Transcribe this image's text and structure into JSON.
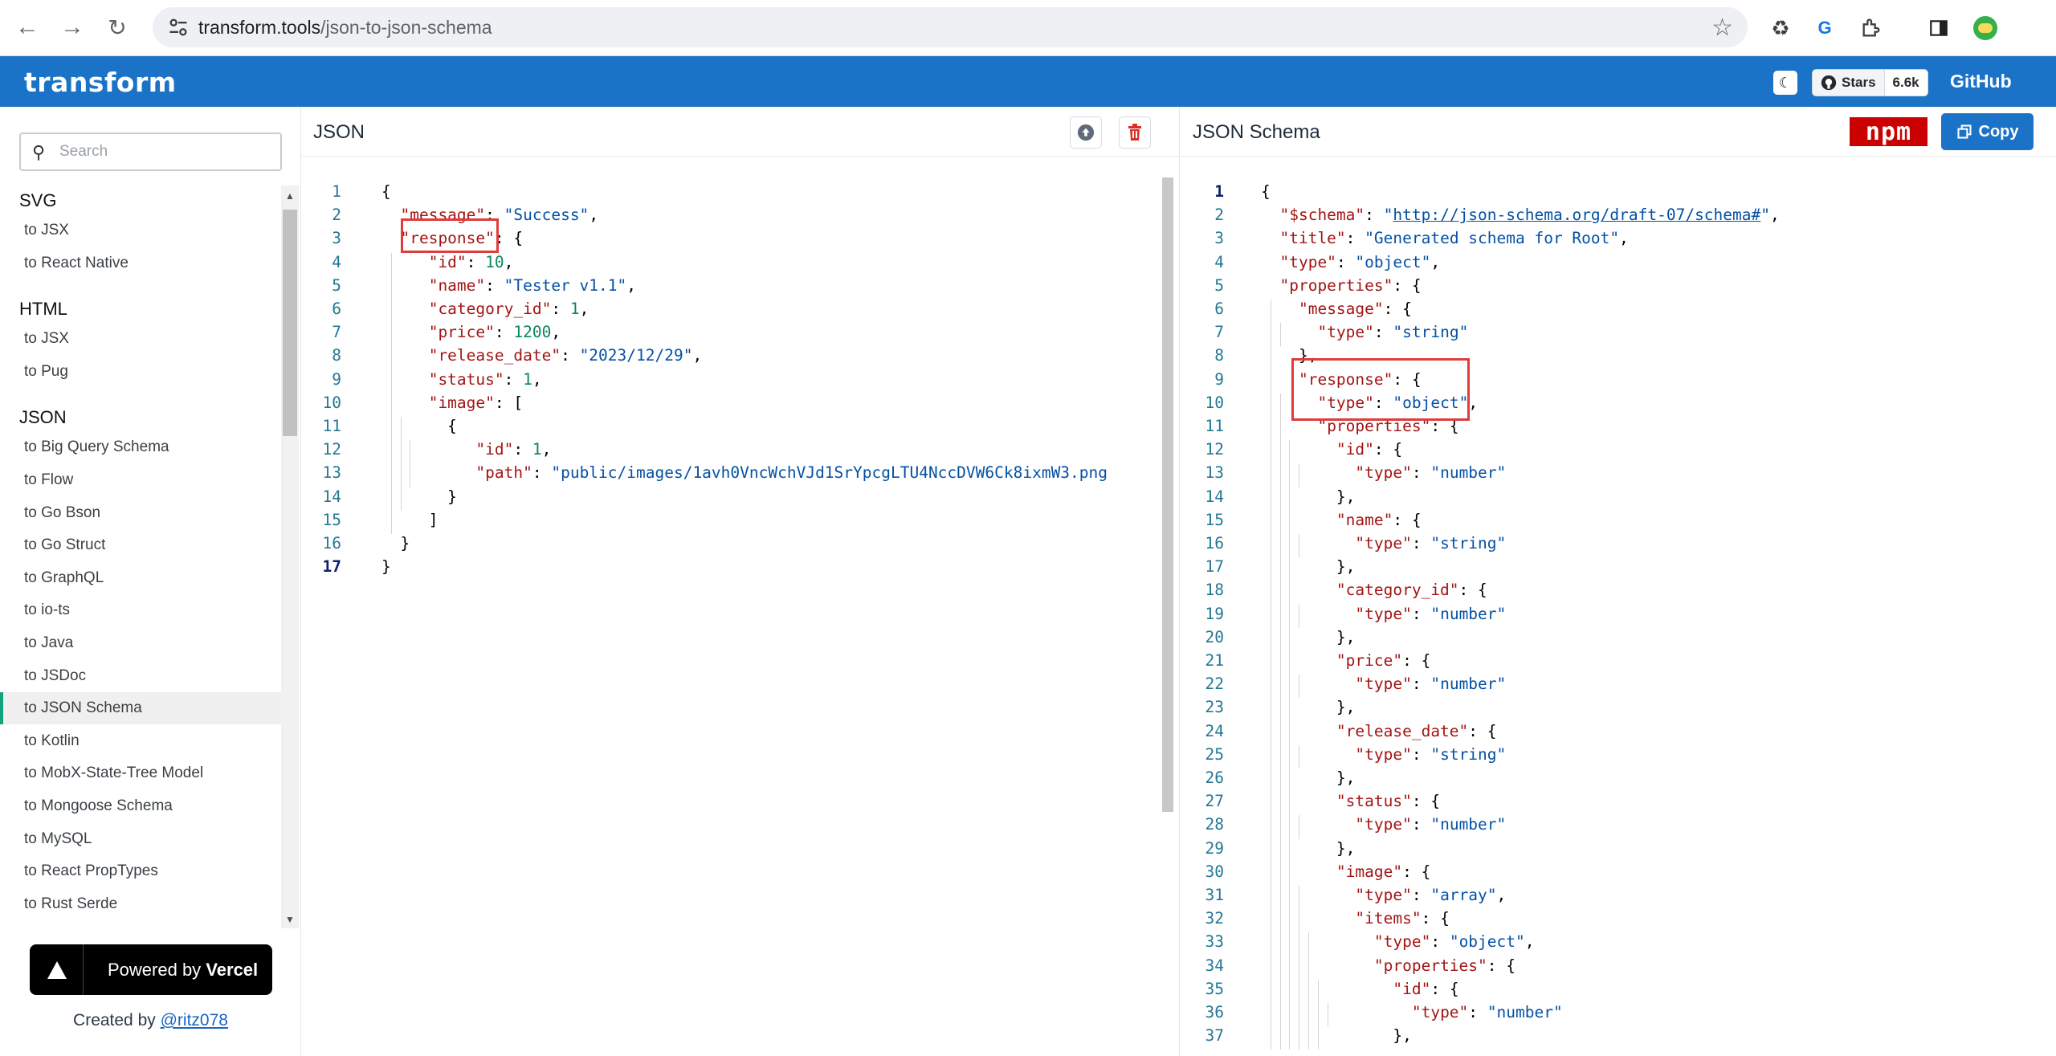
{
  "browser": {
    "url_host": "transform.tools",
    "url_path": "/json-to-json-schema"
  },
  "header": {
    "logo": "transform",
    "stars_label": "Stars",
    "stars_count": "6.6k",
    "github_label": "GitHub"
  },
  "sidebar": {
    "search_placeholder": "Search",
    "sections": [
      {
        "title": "SVG",
        "items": [
          "to JSX",
          "to React Native"
        ]
      },
      {
        "title": "HTML",
        "items": [
          "to JSX",
          "to Pug"
        ]
      },
      {
        "title": "JSON",
        "items": [
          "to Big Query Schema",
          "to Flow",
          "to Go Bson",
          "to Go Struct",
          "to GraphQL",
          "to io-ts",
          "to Java",
          "to JSDoc",
          "to JSON Schema",
          "to Kotlin",
          "to MobX-State-Tree Model",
          "to Mongoose Schema",
          "to MySQL",
          "to React PropTypes",
          "to Rust Serde"
        ]
      }
    ],
    "active_item": "to JSON Schema",
    "vercel_prefix": "Powered by",
    "vercel_brand": "Vercel",
    "created_prefix": "Created by",
    "created_author": "@ritz078"
  },
  "left_panel": {
    "title": "JSON",
    "lines": [
      "{",
      "  \"message\": \"Success\",",
      "  \"response\": {",
      "    \"id\": 10,",
      "    \"name\": \"Tester v1.1\",",
      "    \"category_id\": 1,",
      "    \"price\": 1200,",
      "    \"release_date\": \"2023/12/29\",",
      "    \"status\": 1,",
      "    \"image\": [",
      "      {",
      "        \"id\": 1,",
      "        \"path\": \"public/images/1avh0VncWchVJd1SrYpcgLTU4NccDVW6Ck8ixmW3.png",
      "      }",
      "    ]",
      "  }",
      "}"
    ]
  },
  "right_panel": {
    "title": "JSON Schema",
    "npm_label": "npm",
    "copy_label": "Copy",
    "lines": [
      "{",
      "  \"$schema\": \"http://json-schema.org/draft-07/schema#\",",
      "  \"title\": \"Generated schema for Root\",",
      "  \"type\": \"object\",",
      "  \"properties\": {",
      "    \"message\": {",
      "      \"type\": \"string\"",
      "    },",
      "    \"response\": {",
      "      \"type\": \"object\",",
      "      \"properties\": {",
      "        \"id\": {",
      "          \"type\": \"number\"",
      "        },",
      "        \"name\": {",
      "          \"type\": \"string\"",
      "        },",
      "        \"category_id\": {",
      "          \"type\": \"number\"",
      "        },",
      "        \"price\": {",
      "          \"type\": \"number\"",
      "        },",
      "        \"release_date\": {",
      "          \"type\": \"string\"",
      "        },",
      "        \"status\": {",
      "          \"type\": \"number\"",
      "        },",
      "        \"image\": {",
      "          \"type\": \"array\",",
      "          \"items\": {",
      "            \"type\": \"object\",",
      "            \"properties\": {",
      "              \"id\": {",
      "                \"type\": \"number\"",
      "              },"
    ]
  },
  "colors": {
    "accent": "#1a73c7",
    "key": "#a31515",
    "string": "#0451a5",
    "number": "#098658",
    "highlight": "#e03c3c"
  }
}
